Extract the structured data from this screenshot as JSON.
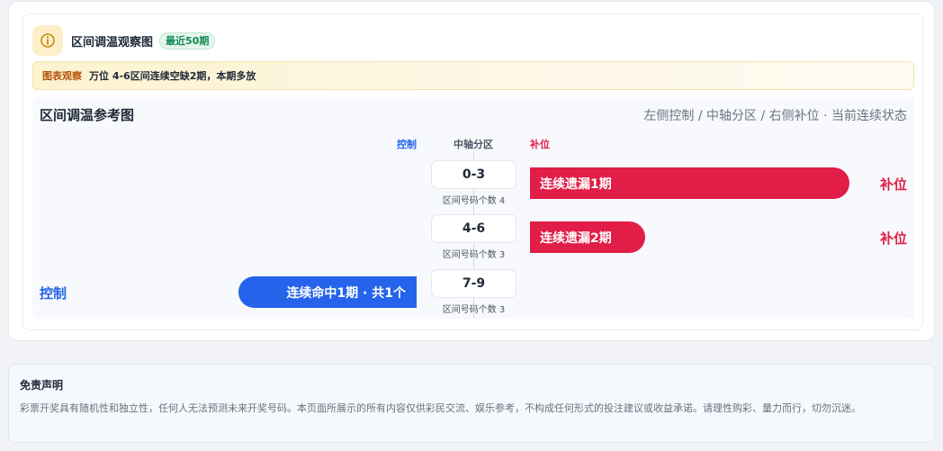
{
  "header": {
    "title": "区间调温观察图",
    "badge": "最近50期",
    "icon": "info-circle-icon"
  },
  "observation": {
    "tag": "图表观察",
    "text": "万位 4-6区间连续空缺2期，本期多放"
  },
  "chart": {
    "title": "区间调温参考图",
    "subtitle": "左侧控制 / 中轴分区 / 右侧补位 · 当前连续状态",
    "columns": {
      "left": "控制",
      "middle": "中轴分区",
      "right": "补位"
    },
    "zones": [
      {
        "range": "0-3",
        "count_label": "区间号码个数 4",
        "bar_text": "连续遗漏1期",
        "side_label": "补位"
      },
      {
        "range": "4-6",
        "count_label": "区间号码个数 3",
        "bar_text": "连续遗漏2期",
        "side_label": "补位"
      },
      {
        "range": "7-9",
        "count_label": "区间号码个数 3",
        "bar_text": "连续命中1期 · 共1个",
        "side_label": "控制"
      }
    ],
    "bar_fill": [
      1.0,
      0.36,
      1.0
    ]
  },
  "disclaimer": {
    "title": "免责声明",
    "text": "彩票开奖具有随机性和独立性，任何人无法预测未来开奖号码。本页面所展示的所有内容仅供彩民交流、娱乐参考，不构成任何形式的投注建议或收益承诺。请理性购彩、量力而行，切勿沉迷。"
  },
  "colors": {
    "supplement": "#e11d48",
    "control": "#2563eb",
    "badge_green": "#138a52",
    "observe_tag": "#b45309"
  }
}
